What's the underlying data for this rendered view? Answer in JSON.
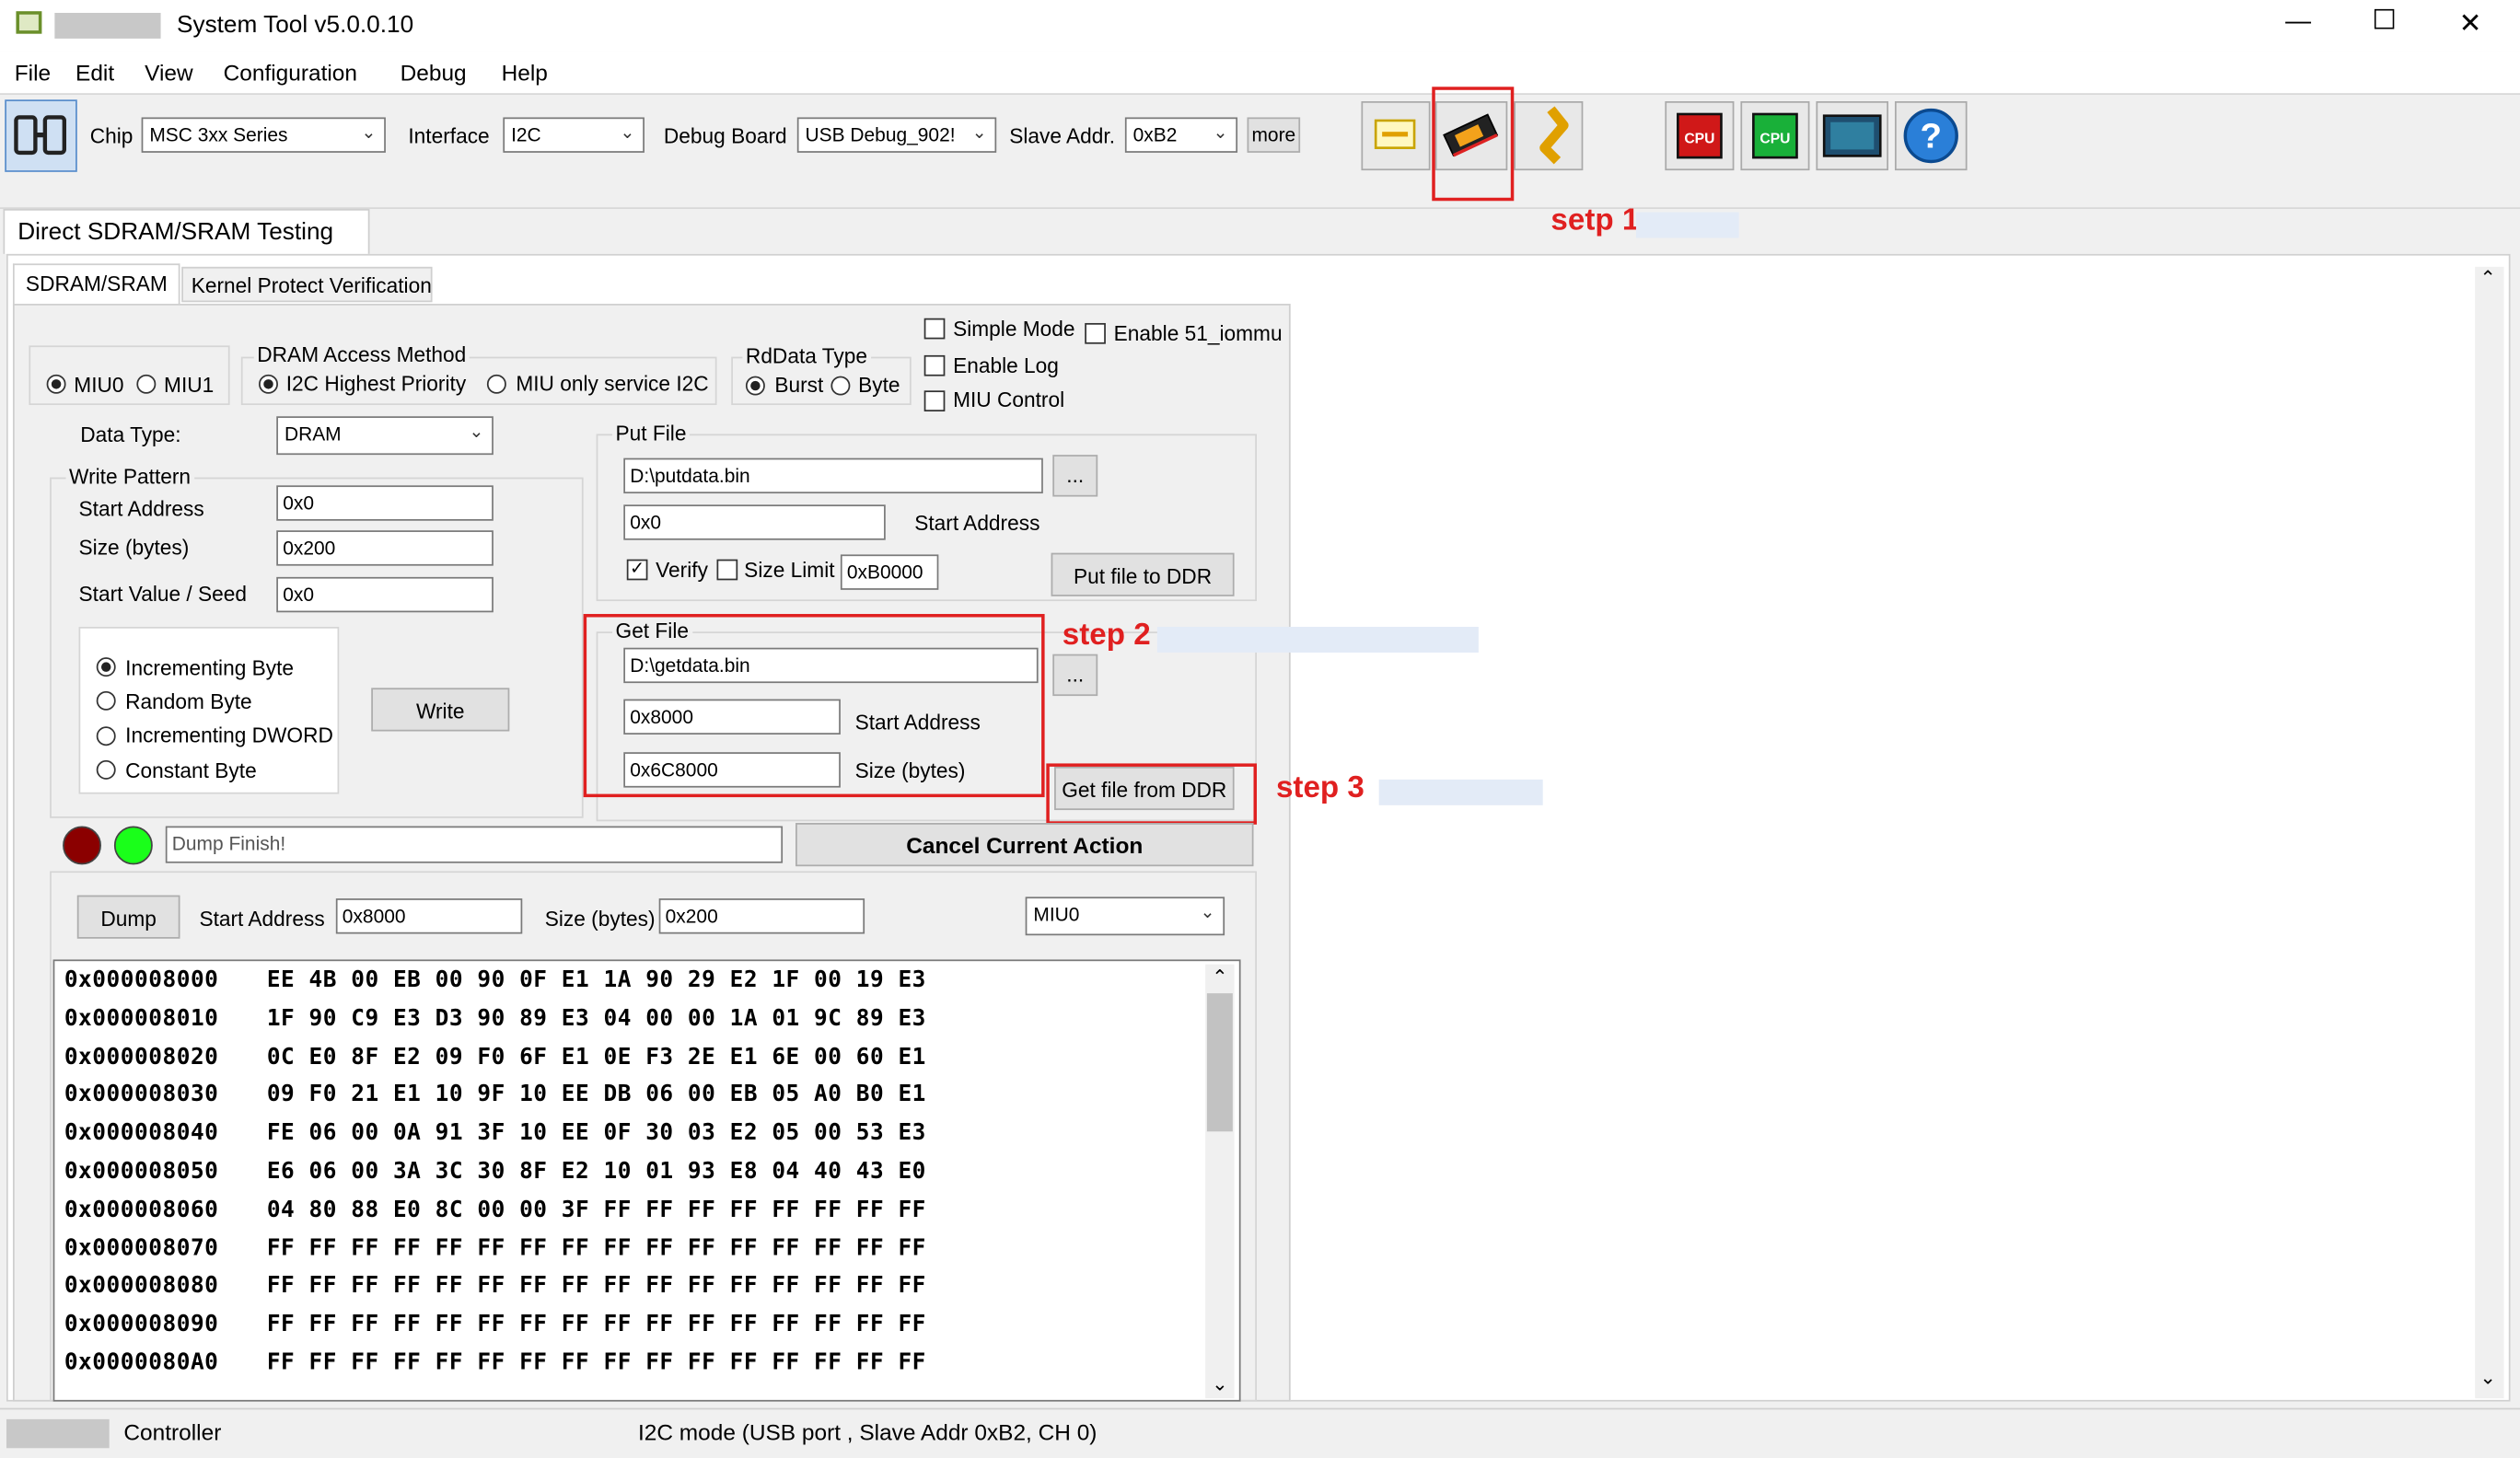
{
  "window": {
    "title": "System Tool v5.0.0.10",
    "minimize": "—",
    "maximize": "☐",
    "close": "✕"
  },
  "menu": [
    "File",
    "Edit",
    "View",
    "Configuration",
    "Debug",
    "Help"
  ],
  "toolbar": {
    "chip_label": "Chip",
    "chip_value": "MSC 3xx Series",
    "interface_label": "Interface",
    "interface_value": "I2C",
    "debug_board_label": "Debug Board",
    "debug_board_value": "USB Debug_902!",
    "slave_addr_label": "Slave Addr.",
    "slave_addr_value": "0xB2",
    "more_label": "more",
    "icons": [
      "connect-icon",
      "memory-view-icon",
      "sdram-chip-icon",
      "flash-icon",
      "cpu-red-icon",
      "cpu-green-icon",
      "monitor-icon",
      "help-icon"
    ]
  },
  "page_tab": "Direct SDRAM/SRAM Testing",
  "tabs": [
    "SDRAM/SRAM",
    "Kernel Protect Verification"
  ],
  "miu": {
    "miu0": "MIU0",
    "miu1": "MIU1"
  },
  "access": {
    "title": "DRAM Access Method",
    "opt1": "I2C Highest Priority",
    "opt2": "MIU only service I2C"
  },
  "rddata": {
    "title": "RdData Type",
    "burst": "Burst",
    "byte": "Byte"
  },
  "options": {
    "simple_mode": "Simple Mode",
    "enable_51": "Enable 51_iommu",
    "enable_log": "Enable Log",
    "miu_control": "MIU Control"
  },
  "data_type": {
    "label": "Data Type:",
    "value": "DRAM"
  },
  "write_pattern": {
    "title": "Write Pattern",
    "start_label": "Start Address",
    "start_value": "0x0",
    "size_label": "Size (bytes)",
    "size_value": "0x200",
    "seed_label": "Start Value / Seed",
    "seed_value": "0x0",
    "patterns": [
      "Incrementing Byte",
      "Random Byte",
      "Incrementing DWORD",
      "Constant Byte"
    ],
    "write_button": "Write"
  },
  "put_file": {
    "title": "Put File",
    "path": "D:\\putdata.bin",
    "browse": "...",
    "start_value": "0x0",
    "start_label": "Start Address",
    "verify": "Verify",
    "size_limit": "Size Limit",
    "size_limit_value": "0xB0000",
    "button": "Put file to DDR"
  },
  "get_file": {
    "title": "Get File",
    "path": "D:\\getdata.bin",
    "browse": "...",
    "start_value": "0x8000",
    "start_label": "Start Address",
    "size_value": "0x6C8000",
    "size_label": "Size (bytes)",
    "button": "Get file from DDR"
  },
  "status": {
    "message": "Dump Finish!",
    "cancel": "Cancel Current Action",
    "led_colors": [
      "#8b0000",
      "#1aff1a"
    ]
  },
  "dump": {
    "button": "Dump",
    "start_label": "Start Address",
    "start_value": "0x8000",
    "size_label": "Size (bytes)",
    "size_value": "0x200",
    "miu_value": "MIU0"
  },
  "hex_rows": [
    {
      "addr": "0x000008000",
      "bytes": "EE 4B 00 EB 00 90 0F E1 1A 90 29 E2 1F 00 19 E3"
    },
    {
      "addr": "0x000008010",
      "bytes": "1F 90 C9 E3 D3 90 89 E3 04 00 00 1A 01 9C 89 E3"
    },
    {
      "addr": "0x000008020",
      "bytes": "0C E0 8F E2 09 F0 6F E1 0E F3 2E E1 6E 00 60 E1"
    },
    {
      "addr": "0x000008030",
      "bytes": "09 F0 21 E1 10 9F 10 EE DB 06 00 EB 05 A0 B0 E1"
    },
    {
      "addr": "0x000008040",
      "bytes": "FE 06 00 0A 91 3F 10 EE 0F 30 03 E2 05 00 53 E3"
    },
    {
      "addr": "0x000008050",
      "bytes": "E6 06 00 3A 3C 30 8F E2 10 01 93 E8 04 40 43 E0"
    },
    {
      "addr": "0x000008060",
      "bytes": "04 80 88 E0 8C 00 00 3F FF FF FF FF FF FF FF FF"
    },
    {
      "addr": "0x000008070",
      "bytes": "FF FF FF FF FF FF FF FF FF FF FF FF FF FF FF FF"
    },
    {
      "addr": "0x000008080",
      "bytes": "FF FF FF FF FF FF FF FF FF FF FF FF FF FF FF FF"
    },
    {
      "addr": "0x000008090",
      "bytes": "FF FF FF FF FF FF FF FF FF FF FF FF FF FF FF FF"
    },
    {
      "addr": "0x0000080A0",
      "bytes": "FF FF FF FF FF FF FF FF FF FF FF FF FF FF FF FF"
    }
  ],
  "steps": {
    "step1": "setp 1",
    "step2": "step 2",
    "step3": "step 3"
  },
  "statusbar": {
    "left": "Controller",
    "right": "I2C mode (USB port , Slave Addr 0xB2, CH 0)"
  }
}
